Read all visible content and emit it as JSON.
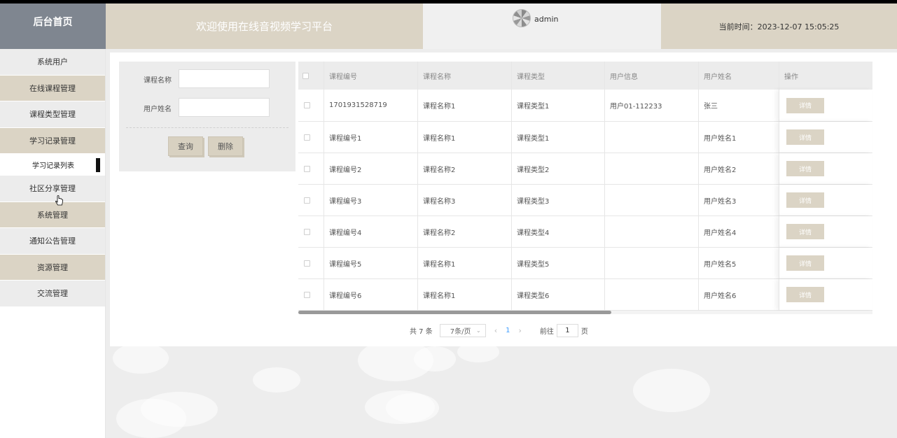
{
  "header": {
    "brand": "后台首页",
    "welcome": "欢迎使用在线音视频学习平台",
    "username": "admin",
    "time": "当前时间：2023-12-07 15:05:25"
  },
  "sidebar": {
    "items": [
      {
        "label": "系统用户"
      },
      {
        "label": "在线课程管理"
      },
      {
        "label": "课程类型管理"
      },
      {
        "label": "学习记录管理"
      },
      {
        "label": "社区分享管理"
      },
      {
        "label": "系统管理"
      },
      {
        "label": "通知公告管理"
      },
      {
        "label": "资源管理"
      },
      {
        "label": "交流管理"
      }
    ],
    "submenu": "学习记录列表"
  },
  "search": {
    "course_name_label": "课程名称",
    "user_name_label": "用户姓名",
    "course_name_value": "",
    "user_name_value": "",
    "query_button": "查询",
    "delete_button": "删除"
  },
  "table": {
    "headers": [
      "课程编号",
      "课程名称",
      "课程类型",
      "用户信息",
      "用户姓名",
      "操作"
    ],
    "detail_label": "详情",
    "rows": [
      {
        "code": "1701931528719",
        "name": "课程名称1",
        "type": "课程类型1",
        "info": "用户01-112233",
        "user": "张三"
      },
      {
        "code": "课程编号1",
        "name": "课程名称1",
        "type": "课程类型1",
        "info": "",
        "user": "用户姓名1"
      },
      {
        "code": "课程编号2",
        "name": "课程名称2",
        "type": "课程类型2",
        "info": "",
        "user": "用户姓名2"
      },
      {
        "code": "课程编号3",
        "name": "课程名称3",
        "type": "课程类型3",
        "info": "",
        "user": "用户姓名3"
      },
      {
        "code": "课程编号4",
        "name": "课程名称2",
        "type": "课程类型4",
        "info": "",
        "user": "用户姓名4"
      },
      {
        "code": "课程编号5",
        "name": "课程名称1",
        "type": "课程类型5",
        "info": "",
        "user": "用户姓名5"
      },
      {
        "code": "课程编号6",
        "name": "课程名称1",
        "type": "课程类型6",
        "info": "",
        "user": "用户姓名6"
      }
    ]
  },
  "pagination": {
    "total": "共 7 条",
    "page_size": "7条/页",
    "current_page": "1",
    "goto_label": "前往",
    "goto_value": "1",
    "page_suffix": "页"
  },
  "colors": {
    "tan": "#dbd4c5",
    "slate": "#7f8690",
    "light_gray": "#ececec",
    "accent_blue": "#409eff"
  },
  "icons": [
    "avatar",
    "chevron-down-icon",
    "chevron-left-icon",
    "chevron-right-icon",
    "pointer-cursor-icon"
  ]
}
